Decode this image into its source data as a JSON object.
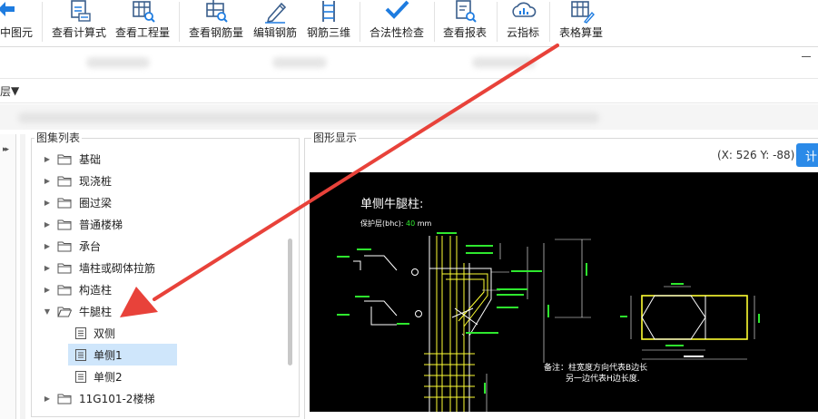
{
  "toolbar": {
    "buttons": [
      {
        "label": "中图元"
      },
      {
        "label": "查看计算式"
      },
      {
        "label": "查看工程量"
      },
      {
        "label": "查看钢筋量"
      },
      {
        "label": "编辑钢筋"
      },
      {
        "label": "钢筋三维"
      },
      {
        "label": "合法性检查"
      },
      {
        "label": "查看报表"
      },
      {
        "label": "云指标"
      },
      {
        "label": "表格算量"
      }
    ]
  },
  "floor_bar": {
    "label": "层"
  },
  "left_panel": {
    "title": "图集列表"
  },
  "right_panel": {
    "title": "图形显示",
    "coords": "(X: 526 Y: -88)",
    "button_label": "计"
  },
  "tree": {
    "items": [
      {
        "label": "基础",
        "level": 0,
        "expanded": false
      },
      {
        "label": "现浇桩",
        "level": 0,
        "expanded": false
      },
      {
        "label": "圈过梁",
        "level": 0,
        "expanded": false
      },
      {
        "label": "普通楼梯",
        "level": 0,
        "expanded": false
      },
      {
        "label": "承台",
        "level": 0,
        "expanded": false
      },
      {
        "label": "墙柱或砌体拉筋",
        "level": 0,
        "expanded": false
      },
      {
        "label": "构造柱",
        "level": 0,
        "expanded": false
      },
      {
        "label": "牛腿柱",
        "level": 0,
        "expanded": true
      },
      {
        "label": "双侧",
        "level": 1,
        "selected": false
      },
      {
        "label": "单侧1",
        "level": 1,
        "selected": true
      },
      {
        "label": "单侧2",
        "level": 1,
        "selected": false
      },
      {
        "label": "11G101-2楼梯",
        "level": 0,
        "expanded": false
      }
    ]
  },
  "drawing": {
    "title": "单侧牛腿柱:",
    "cover_label": "保护层(bhc):",
    "cover_value": "40",
    "cover_unit": "mm",
    "note_line1": "备注：柱宽度方向代表B边长",
    "note_line2": "另一边代表H边长度."
  },
  "colors": {
    "accent": "#1e7ce0",
    "selection": "#cfe6fb",
    "annotation_arrow": "#e8423a",
    "canvas_bg": "#000000",
    "drawing_yellow": "#ffff33",
    "drawing_green": "#2ee82e"
  }
}
